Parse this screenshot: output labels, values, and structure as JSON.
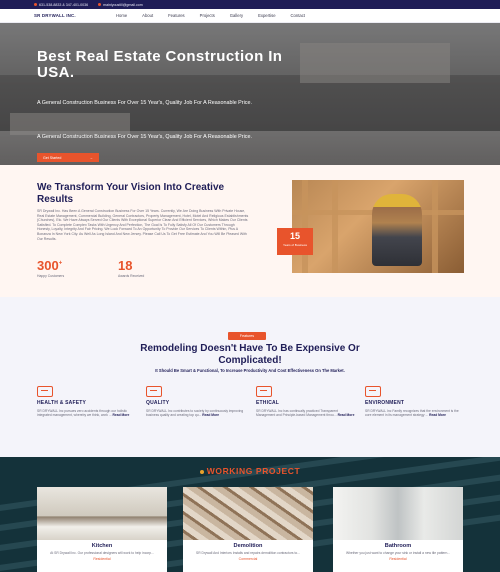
{
  "topbar": {
    "phone": "631-538-8833 & 347-401-0036",
    "email": "mainlyoustlll@gmail.com"
  },
  "nav": {
    "brand": "SR DRYWALL INC.",
    "items": [
      "Home",
      "About",
      "Features",
      "Projects",
      "Gallery",
      "Expertise",
      "Contact"
    ]
  },
  "hero": {
    "title": "Best Real Estate Construction In USA.",
    "subtitle_1": "A General Construction Business For Over 15 Year's, Quality Job For A Reasonable Price.",
    "subtitle_2": "A General Construction Business For Over 15 Year's, Quality Job For A Reasonable Price.",
    "cta_label": "Get Started",
    "cta_arrow": "→"
  },
  "about": {
    "title": "We Transform Your Vision Into Creative Results",
    "paragraph": "SR Drywall Inc. Has Been A General Construction Business For Over 15 Years. Currently, We Are Doing Business With Private House, Real Estate Management, Commercial Building, General Contractors, Property Management, Hotel, Motel And Religious Establishments (Churches), Etc. We Have Always Served Our Clients With Exceptional Superior Clean And Efficient Services, Which Makes Our Clients Satisfied. To Complete Complex Tasks With Urgency And Perfection, The Goal Is To Fully Satisfy All Of Our Customers Through Honesty, Loyalty, Integrity And Fair Pricing. We Look Forward To An Opportunity To Provide Our Services To Clients Within, Plus A Bonanza In New York City. As Well As Long Island And New Jersey. Please Call Us To Get Free Estimate And You Will Be Pleased With Our Results.",
    "stats": [
      {
        "value": "300",
        "suffix": "+",
        "label": "Happy Customers"
      },
      {
        "value": "18",
        "suffix": "",
        "label": "Awards Received"
      }
    ],
    "badge_number": "15",
    "badge_label": "Years of Business"
  },
  "features": {
    "pill": "Features",
    "title": "Remodeling Doesn't Have To Be Expensive Or Complicated!",
    "subtitle": "It Should Be Smart & Functional, To Increase Productivity And Cost Effectiveness On The Market.",
    "cards": [
      {
        "icon": "hard-hat-icon",
        "title": "HEALTH & SAFETY",
        "text": "SR DRYWALL Inc pursues zero accidents through our holistic integrated management, whereby we think, work ...",
        "more": "Read More"
      },
      {
        "icon": "medal-icon",
        "title": "QUALITY",
        "text": "SR DRYWALL Inc contributes to society by continuously improving business quality and creating top qu...",
        "more": "Read More"
      },
      {
        "icon": "handshake-icon",
        "title": "ETHICAL",
        "text": "SR DRYWALL Inc has continually practiced Transparent Management and Principle-based Management throu...",
        "more": "Read More"
      },
      {
        "icon": "leaf-icon",
        "title": "ENVIRONMENT",
        "text": "SR DRYWALL Inc Family recognizes that the environment is the core element in its management strategy ...",
        "more": "Read More"
      }
    ]
  },
  "projects": {
    "heading": "WORKING PROJECT",
    "items": [
      {
        "name": "Kitchen",
        "desc": "At SR Drywall Inc. Our professional designers will work to help incorp...",
        "tag": "Residential"
      },
      {
        "name": "Demolition",
        "desc": "SR Drywall And Interiors Installs and repairs demolition contractors to...",
        "tag": "Commercial"
      },
      {
        "name": "Bathroom",
        "desc": "Whether you just want to change your sink or install a new tile pattern...",
        "tag": "Residential"
      }
    ]
  },
  "colors": {
    "accent": "#e8542c",
    "navy": "#1f1d57",
    "dark_teal": "#14323a"
  }
}
